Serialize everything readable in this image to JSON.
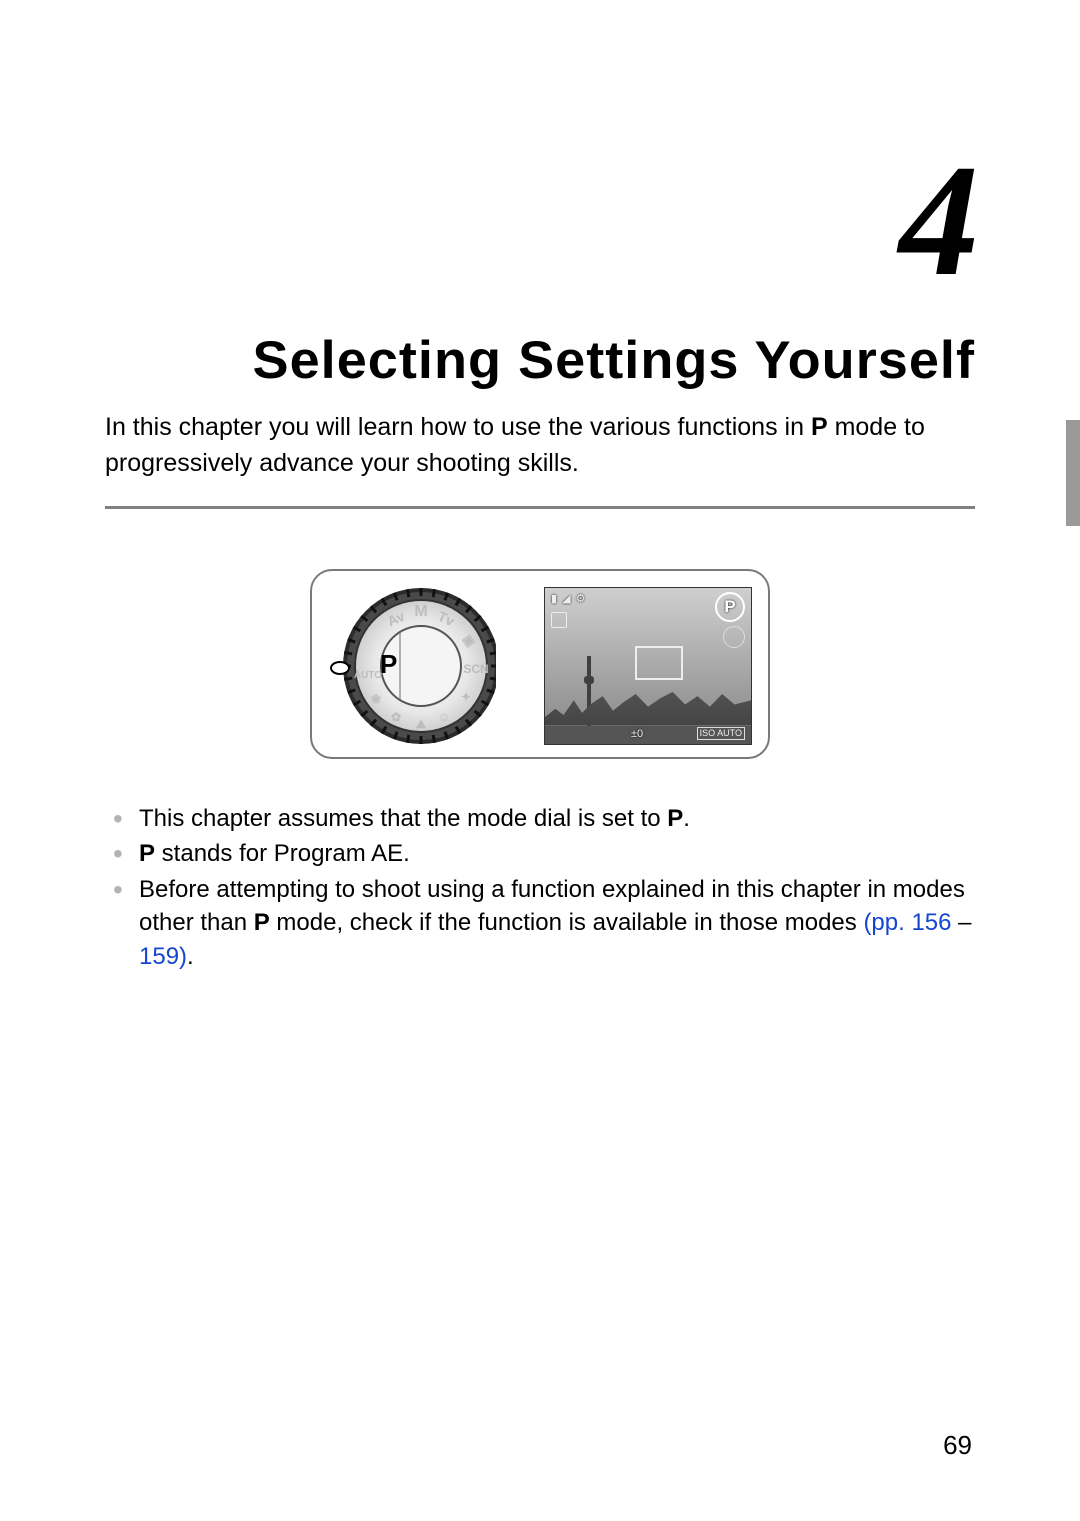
{
  "chapter_number": "4",
  "chapter_title": "Selecting Settings Yourself",
  "intro": {
    "part1": "In this chapter you will learn how to use the various functions in ",
    "p_symbol": "P",
    "part2": " mode to progressively advance your shooting skills."
  },
  "figure": {
    "dial_mode_label": "P",
    "lcd": {
      "top_osd": "▮ ◢ ⚙",
      "p_indicator": "P",
      "ev_label": "±0",
      "iso_label": "ISO AUTO"
    }
  },
  "bullets": {
    "b1": {
      "before": "This chapter assumes that the mode dial is set to ",
      "p": "P",
      "after": "."
    },
    "b2": {
      "p": "P",
      "after": " stands for Program AE."
    },
    "b3": {
      "line1_before": "Before attempting to shoot using a function explained in this chapter in modes other than ",
      "p": "P",
      "line1_after": " mode, check if the function is available in those modes ",
      "link1": "(pp. 156",
      "dash": " – ",
      "link2": "159)",
      "period": "."
    }
  },
  "page_number": "69"
}
